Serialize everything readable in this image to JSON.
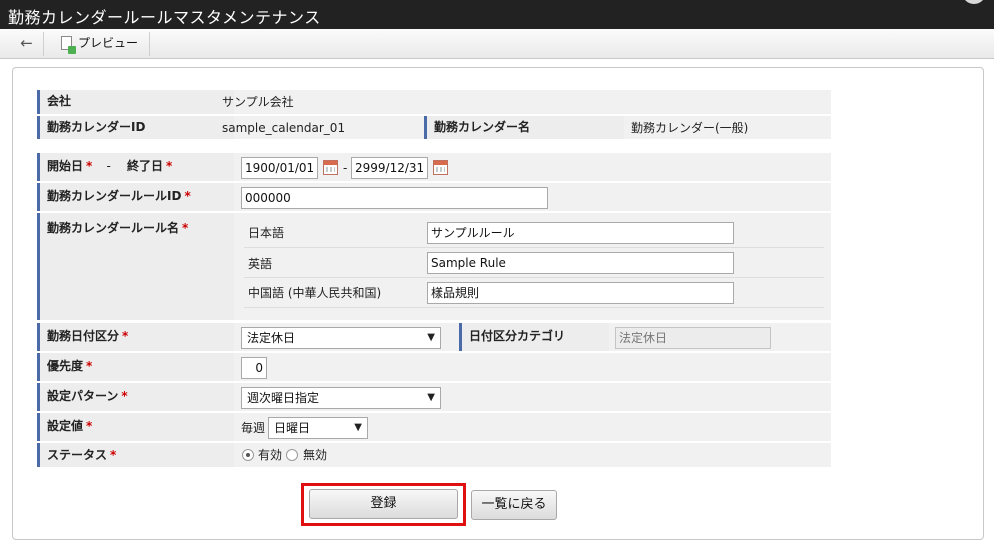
{
  "window": {
    "title": "勤務カレンダールールマスタメンテナンス"
  },
  "toolbar": {
    "back_icon": "←",
    "preview_label": "プレビュー"
  },
  "form": {
    "company": {
      "label": "会社",
      "value": "サンプル会社"
    },
    "calendar_id": {
      "label": "勤務カレンダーID",
      "value": "sample_calendar_01"
    },
    "calendar_name": {
      "label": "勤務カレンダー名",
      "value": "勤務カレンダー(一般)"
    },
    "period": {
      "start_label": "開始日",
      "end_label": "終了日",
      "separator": "-",
      "start_value": "1900/01/01",
      "end_value": "2999/12/31",
      "range_separator": "-"
    },
    "rule_id": {
      "label": "勤務カレンダールールID",
      "value": "000000"
    },
    "rule_name": {
      "label": "勤務カレンダールール名",
      "languages": [
        {
          "name": "日本語",
          "value": "サンプルルール"
        },
        {
          "name": "英語",
          "value": "Sample Rule"
        },
        {
          "name": "中国語 (中華人民共和国)",
          "value": "樣品規則"
        }
      ]
    },
    "date_type": {
      "label": "勤務日付区分",
      "value": "法定休日"
    },
    "date_category": {
      "label": "日付区分カテゴリ",
      "value": "法定休日"
    },
    "priority": {
      "label": "優先度",
      "value": "0"
    },
    "pattern": {
      "label": "設定パターン",
      "value": "週次曜日指定"
    },
    "setting_value": {
      "label": "設定値",
      "prefix": "毎週",
      "value": "日曜日"
    },
    "status": {
      "label": "ステータス",
      "option_enabled": "有効",
      "option_disabled": "無効",
      "selected": "有効"
    },
    "required_mark": "*"
  },
  "actions": {
    "register_label": "登録",
    "back_to_list_label": "一覧に戻る"
  },
  "colors": {
    "accent_bar": "#4b6aa8",
    "required": "#cc0000",
    "highlight": "#e01010"
  }
}
